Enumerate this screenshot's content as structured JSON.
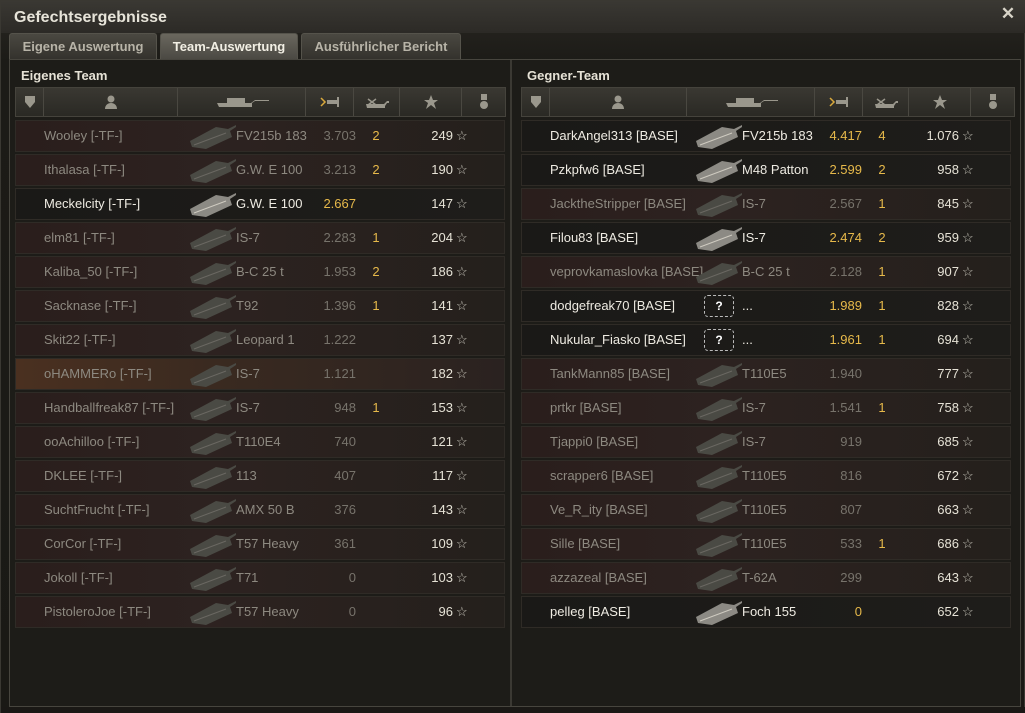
{
  "window": {
    "title": "Gefechtsergebnisse"
  },
  "tabs": [
    {
      "label": "Eigene Auswertung",
      "active": false
    },
    {
      "label": "Team-Auswertung",
      "active": true
    },
    {
      "label": "Ausführlicher Bericht",
      "active": false
    }
  ],
  "own_team": {
    "title": "Eigenes Team",
    "rows": [
      {
        "name": "Wooley [-TF-]",
        "vehicle": "FV215b 183",
        "damage": "3.703",
        "kills": "2",
        "xp": "249",
        "state": "dead"
      },
      {
        "name": "Ithalasa [-TF-]",
        "vehicle": "G.W. E 100",
        "damage": "3.213",
        "kills": "2",
        "xp": "190",
        "state": "dead"
      },
      {
        "name": "Meckelcity [-TF-]",
        "vehicle": "G.W. E 100",
        "damage": "2.667",
        "kills": "",
        "xp": "147",
        "state": "alive"
      },
      {
        "name": "elm81 [-TF-]",
        "vehicle": "IS-7",
        "damage": "2.283",
        "kills": "1",
        "xp": "204",
        "state": "dead"
      },
      {
        "name": "Kaliba_50 [-TF-]",
        "vehicle": "B-C 25 t",
        "damage": "1.953",
        "kills": "2",
        "xp": "186",
        "state": "dead"
      },
      {
        "name": "Sacknase [-TF-]",
        "vehicle": "T92",
        "damage": "1.396",
        "kills": "1",
        "xp": "141",
        "state": "dead"
      },
      {
        "name": "Skit22 [-TF-]",
        "vehicle": "Leopard 1",
        "damage": "1.222",
        "kills": "",
        "xp": "137",
        "state": "dead"
      },
      {
        "name": "oHAMMERo [-TF-]",
        "vehicle": "IS-7",
        "damage": "1.121",
        "kills": "",
        "xp": "182",
        "state": "highlight"
      },
      {
        "name": "Handballfreak87 [-TF-]",
        "vehicle": "IS-7",
        "damage": "948",
        "kills": "1",
        "xp": "153",
        "state": "dead"
      },
      {
        "name": "ooAchilloo [-TF-]",
        "vehicle": "T110E4",
        "damage": "740",
        "kills": "",
        "xp": "121",
        "state": "dead"
      },
      {
        "name": "DKLEE [-TF-]",
        "vehicle": "113",
        "damage": "407",
        "kills": "",
        "xp": "117",
        "state": "dead"
      },
      {
        "name": "SuchtFrucht [-TF-]",
        "vehicle": "AMX 50 B",
        "damage": "376",
        "kills": "",
        "xp": "143",
        "state": "dead"
      },
      {
        "name": "CorCor [-TF-]",
        "vehicle": "T57 Heavy",
        "damage": "361",
        "kills": "",
        "xp": "109",
        "state": "dead"
      },
      {
        "name": "Jokoll [-TF-]",
        "vehicle": "T71",
        "damage": "0",
        "kills": "",
        "xp": "103",
        "state": "dead"
      },
      {
        "name": "PistoleroJoe [-TF-]",
        "vehicle": "T57 Heavy",
        "damage": "0",
        "kills": "",
        "xp": "96",
        "state": "dead"
      }
    ]
  },
  "enemy_team": {
    "title": "Gegner-Team",
    "rows": [
      {
        "name": "DarkAngel313 [BASE]",
        "vehicle": "FV215b 183",
        "damage": "4.417",
        "kills": "4",
        "xp": "1.076",
        "state": "alive"
      },
      {
        "name": "Pzkpfw6 [BASE]",
        "vehicle": "M48 Patton",
        "damage": "2.599",
        "kills": "2",
        "xp": "958",
        "state": "alive"
      },
      {
        "name": "JacktheStripper [BASE]",
        "vehicle": "IS-7",
        "damage": "2.567",
        "kills": "1",
        "xp": "845",
        "state": "dead"
      },
      {
        "name": "Filou83 [BASE]",
        "vehicle": "IS-7",
        "damage": "2.474",
        "kills": "2",
        "xp": "959",
        "state": "alive"
      },
      {
        "name": "veprovkamaslovka [BASE]",
        "vehicle": "B-C 25 t",
        "damage": "2.128",
        "kills": "1",
        "xp": "907",
        "state": "dead"
      },
      {
        "name": "dodgefreak70 [BASE]",
        "vehicle": "...",
        "damage": "1.989",
        "kills": "1",
        "xp": "828",
        "state": "alive",
        "unknown": true
      },
      {
        "name": "Nukular_Fiasko [BASE]",
        "vehicle": "...",
        "damage": "1.961",
        "kills": "1",
        "xp": "694",
        "state": "alive",
        "unknown": true
      },
      {
        "name": "TankMann85 [BASE]",
        "vehicle": "T110E5",
        "damage": "1.940",
        "kills": "",
        "xp": "777",
        "state": "dead"
      },
      {
        "name": "prtkr [BASE]",
        "vehicle": "IS-7",
        "damage": "1.541",
        "kills": "1",
        "xp": "758",
        "state": "dead"
      },
      {
        "name": "Tjappi0 [BASE]",
        "vehicle": "IS-7",
        "damage": "919",
        "kills": "",
        "xp": "685",
        "state": "dead"
      },
      {
        "name": "scrapper6 [BASE]",
        "vehicle": "T110E5",
        "damage": "816",
        "kills": "",
        "xp": "672",
        "state": "dead"
      },
      {
        "name": "Ve_R_ity [BASE]",
        "vehicle": "T110E5",
        "damage": "807",
        "kills": "",
        "xp": "663",
        "state": "dead"
      },
      {
        "name": "Sille [BASE]",
        "vehicle": "T110E5",
        "damage": "533",
        "kills": "1",
        "xp": "686",
        "state": "dead"
      },
      {
        "name": "azzazeal [BASE]",
        "vehicle": "T-62A",
        "damage": "299",
        "kills": "",
        "xp": "643",
        "state": "dead"
      },
      {
        "name": "pelleg [BASE]",
        "vehicle": "Foch 155",
        "damage": "0",
        "kills": "",
        "xp": "652",
        "state": "alive"
      }
    ]
  },
  "icons": {
    "close": "close-icon",
    "rank": "rank-icon",
    "player": "player-icon",
    "tank": "tank-icon",
    "damage": "damage-icon",
    "kills": "kills-icon",
    "xp": "star-icon",
    "medal": "medal-icon"
  },
  "colors": {
    "damage_highlight": "#e6b94a",
    "dead_row": "#2d2220",
    "alive_text": "#eeebe2"
  }
}
